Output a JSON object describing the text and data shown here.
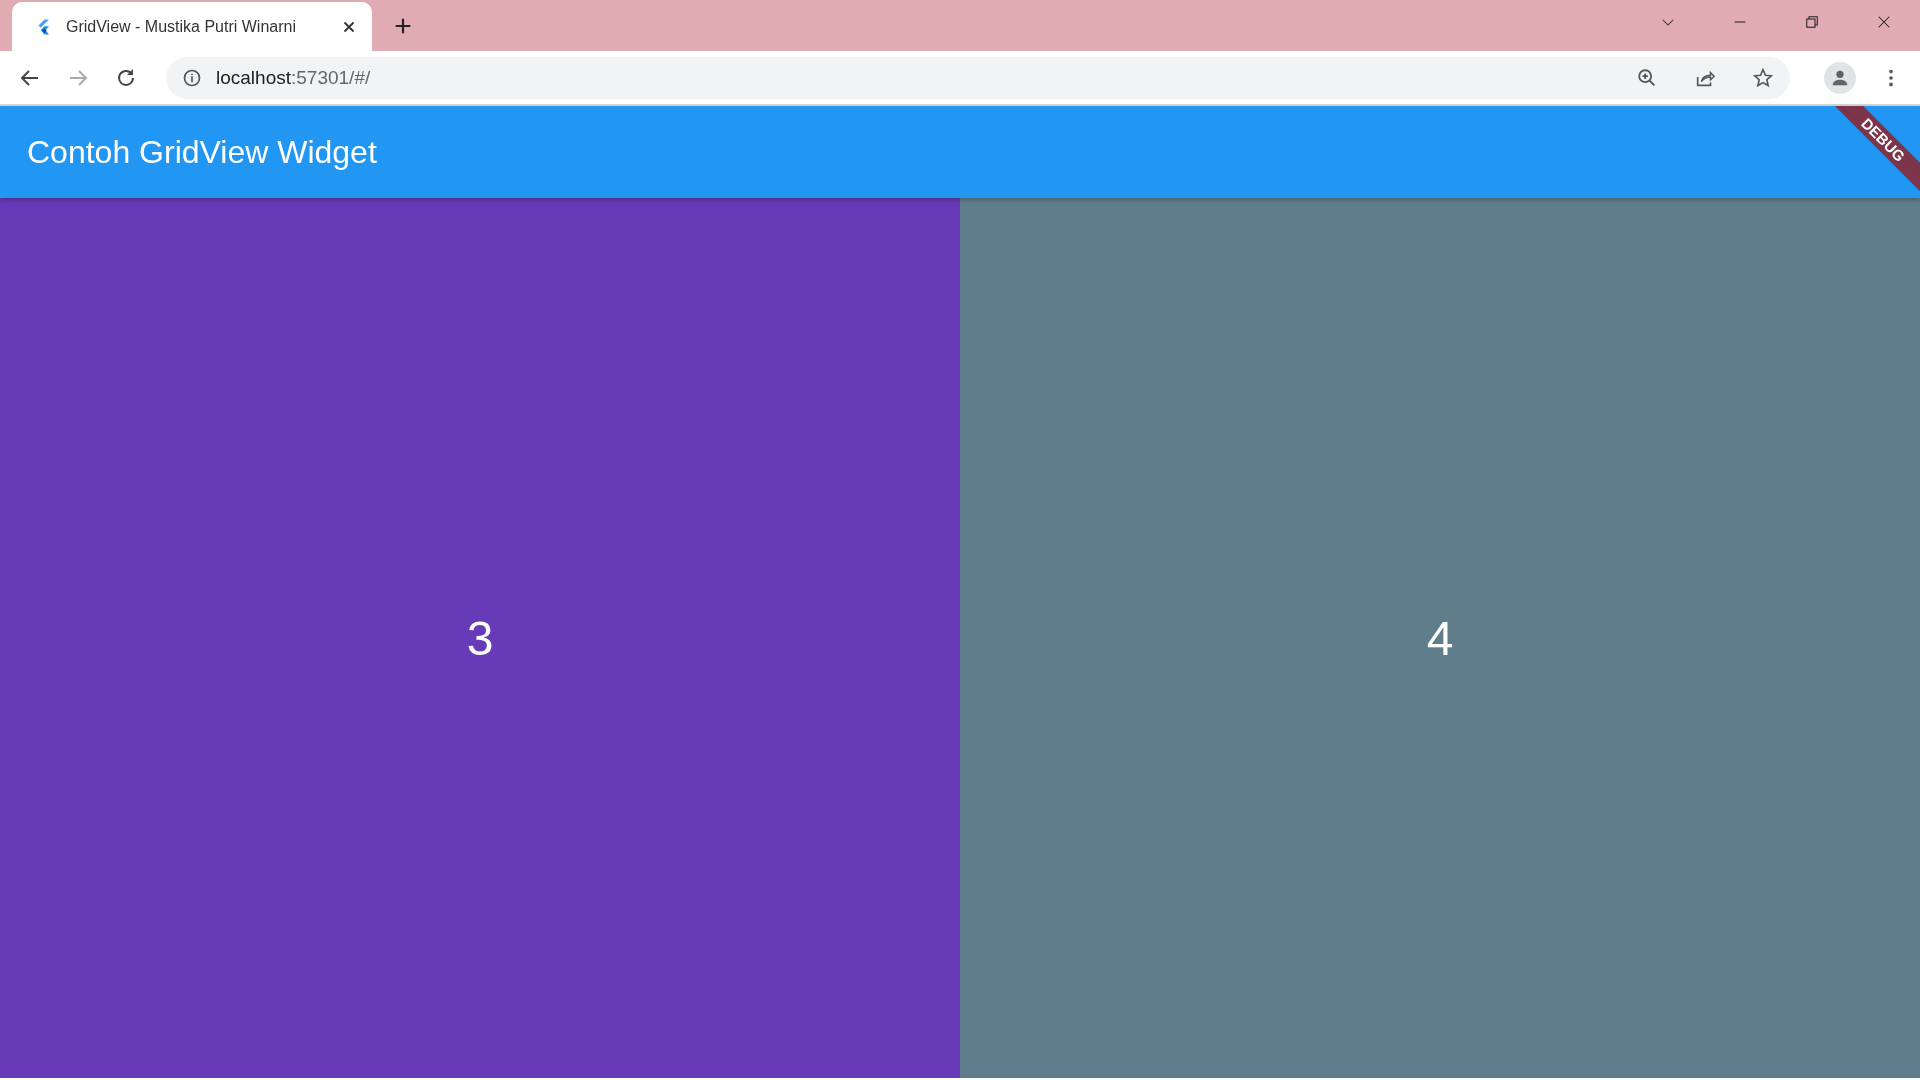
{
  "browser": {
    "tabs": [
      {
        "title": "GridView - Mustika Putri Winarni",
        "selected": true
      }
    ],
    "address": {
      "host": "localhost",
      "rest": ":57301/#/"
    }
  },
  "app_bar": {
    "title": "Contoh GridView Widget",
    "debug_banner": "DEBUG"
  },
  "grid": {
    "tiles": [
      {
        "label": "3",
        "color": "#673ab7"
      },
      {
        "label": "4",
        "color": "#607d8b"
      }
    ]
  }
}
